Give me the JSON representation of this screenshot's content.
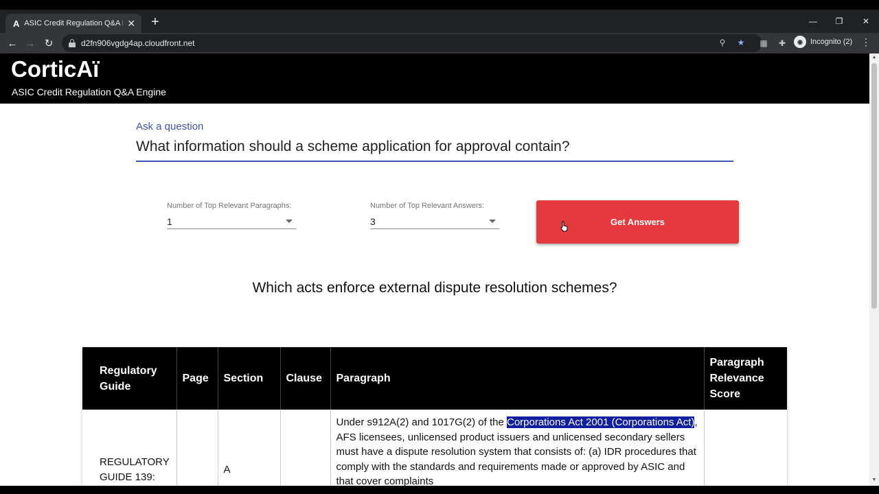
{
  "browser": {
    "tab_title": "ASIC Credit Regulation Q&A Engine",
    "tab_favicon": "A",
    "url": "d2fn906vgdg4ap.cloudfront.net",
    "profile_label": "Incognito (2)"
  },
  "app": {
    "brand": "CorticAï",
    "subtitle": "ASIC Credit Regulation Q&A Engine"
  },
  "question": {
    "label": "Ask a question",
    "value": "What information should a scheme application for approval contain?"
  },
  "controls": {
    "paragraphs_label": "Number of Top Relevant Paragraphs:",
    "paragraphs_value": "1",
    "answers_label": "Number of Top Relevant Answers:",
    "answers_value": "3",
    "submit_label": "Get Answers"
  },
  "result_heading": "Which acts enforce external dispute resolution schemes?",
  "table": {
    "headers": [
      "Regulatory Guide",
      "Page",
      "Section",
      "Clause",
      "Paragraph",
      "Paragraph Relevance Score"
    ],
    "rows": [
      {
        "guide": "REGULATORY GUIDE 139:",
        "page": "",
        "section": "A",
        "clause": "",
        "para_before": "Under s912A(2) and 1017G(2) of the ",
        "para_highlight": "Corporations Act 2001 (Corporations Act)",
        "para_after": ", AFS licensees, unlicensed product issuers and unlicensed secondary sellers must have a dispute resolution system that consists of: (a) IDR procedures that comply with the standards and requirements made or approved by ASIC and that cover complaints",
        "score": ""
      }
    ]
  },
  "colors": {
    "accent": "#3f51b5",
    "button": "#e43a3e",
    "highlight": "#0f1fa0"
  }
}
